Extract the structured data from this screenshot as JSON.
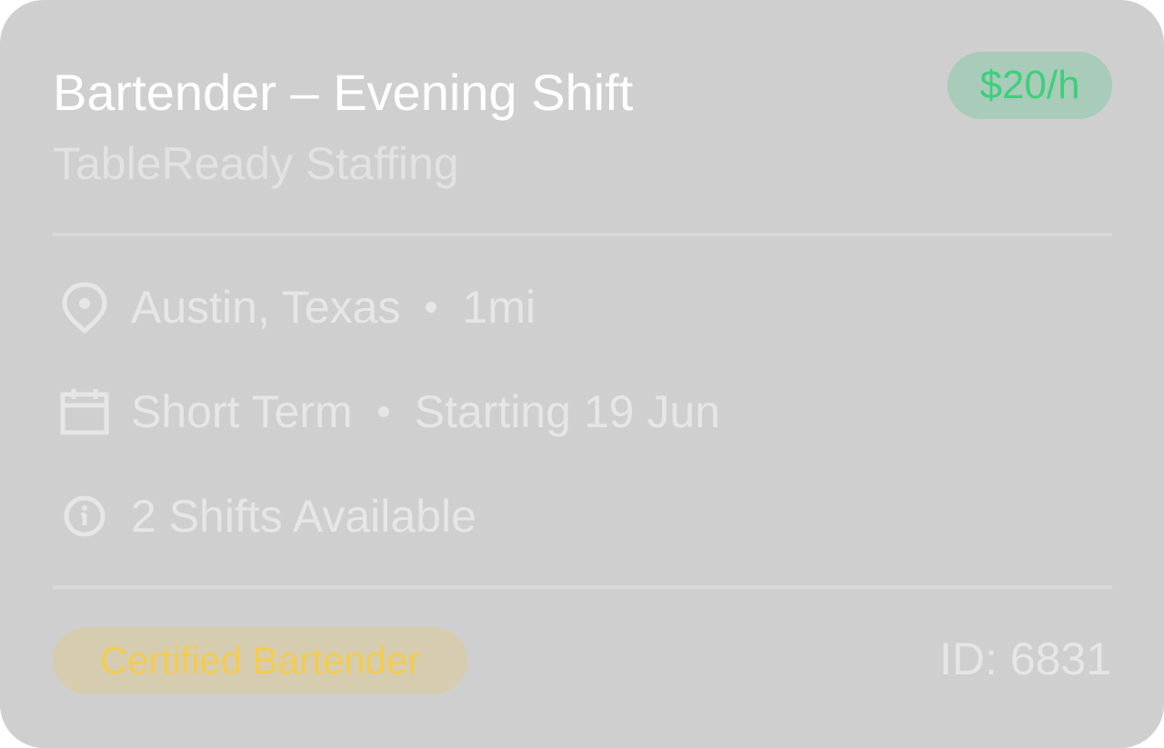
{
  "job": {
    "title": "Bartender – Evening Shift",
    "company": "TableReady Staffing",
    "pay": "$20/h",
    "location": "Austin, Texas",
    "distance": "1mi",
    "term": "Short Term",
    "start": "Starting 19 Jun",
    "shifts": "2 Shifts Available",
    "certification": "Certified Bartender",
    "id": "ID: 6831"
  },
  "icons": {
    "location": "map-pin-icon",
    "calendar": "calendar-icon",
    "info": "info-icon"
  },
  "colors": {
    "card_bg": "#cfcfcf",
    "pay_text": "#3ecf7a",
    "pay_bg": "#a9cbb9",
    "cert_text": "#f3cc4f",
    "cert_bg": "#d6ccb0"
  }
}
